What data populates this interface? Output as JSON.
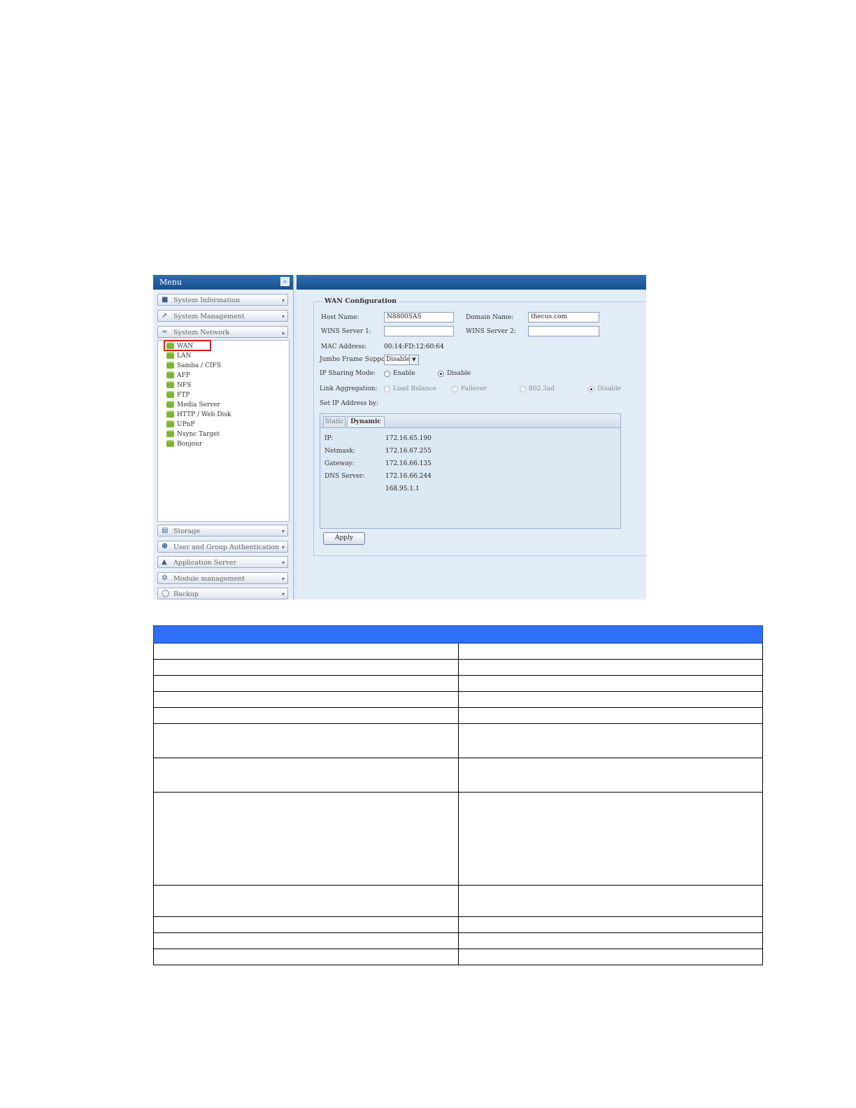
{
  "menu": {
    "title": "Menu",
    "collapse_glyph": "«",
    "categories_top": [
      {
        "label": "System Information",
        "icon": "info-icon"
      },
      {
        "label": "System Management",
        "icon": "wrench-icon"
      },
      {
        "label": "System Network",
        "icon": "network-icon"
      }
    ],
    "network_items": [
      "WAN",
      "LAN",
      "Samba / CIFS",
      "AFP",
      "NFS",
      "FTP",
      "Media Server",
      "HTTP / Web Disk",
      "UPnP",
      "Nsync Target",
      "Bonjour"
    ],
    "categories_bottom": [
      {
        "label": "Storage",
        "icon": "storage-icon"
      },
      {
        "label": "User and Group Authentication",
        "icon": "users-icon"
      },
      {
        "label": "Application Server",
        "icon": "app-server-icon"
      },
      {
        "label": "Module management",
        "icon": "module-icon"
      },
      {
        "label": "Backup",
        "icon": "backup-icon"
      }
    ]
  },
  "wan": {
    "legend": "WAN Configuration",
    "host_name_label": "Host Name:",
    "host_name_value": "N8800SAS",
    "domain_name_label": "Domain Name:",
    "domain_name_value": "thecus.com",
    "wins1_label": "WINS Server 1:",
    "wins1_value": "",
    "wins2_label": "WINS Server 2:",
    "wins2_value": "",
    "mac_label": "MAC Address:",
    "mac_value": "00:14:FD:12:60:64",
    "jumbo_label": "Jumbo Frame Support:",
    "jumbo_value": "Disable",
    "ip_sharing_label": "IP Sharing Mode:",
    "ip_sharing_enable": "Enable",
    "ip_sharing_disable": "Disable",
    "link_agg_label": "Link Aggregation:",
    "link_agg_options": [
      "Load Balance",
      "Failover",
      "802.3ad",
      "Disable"
    ],
    "set_ip_label": "Set IP Address by:",
    "tabs": [
      "Static",
      "Dynamic"
    ],
    "ip_label": "IP:",
    "ip_value": "172.16.65.190",
    "netmask_label": "Netmask:",
    "netmask_value": "172.16.67.255",
    "gateway_label": "Gateway:",
    "gateway_value": "172.16.66.135",
    "dns_label": "DNS Server:",
    "dns_value_1": "172.16.66.244",
    "dns_value_2": "168.95.1.1",
    "apply_label": "Apply"
  },
  "table": {
    "row_heights": [
      24,
      24,
      24,
      24,
      24,
      50,
      50,
      134,
      46,
      24,
      24,
      24
    ]
  }
}
